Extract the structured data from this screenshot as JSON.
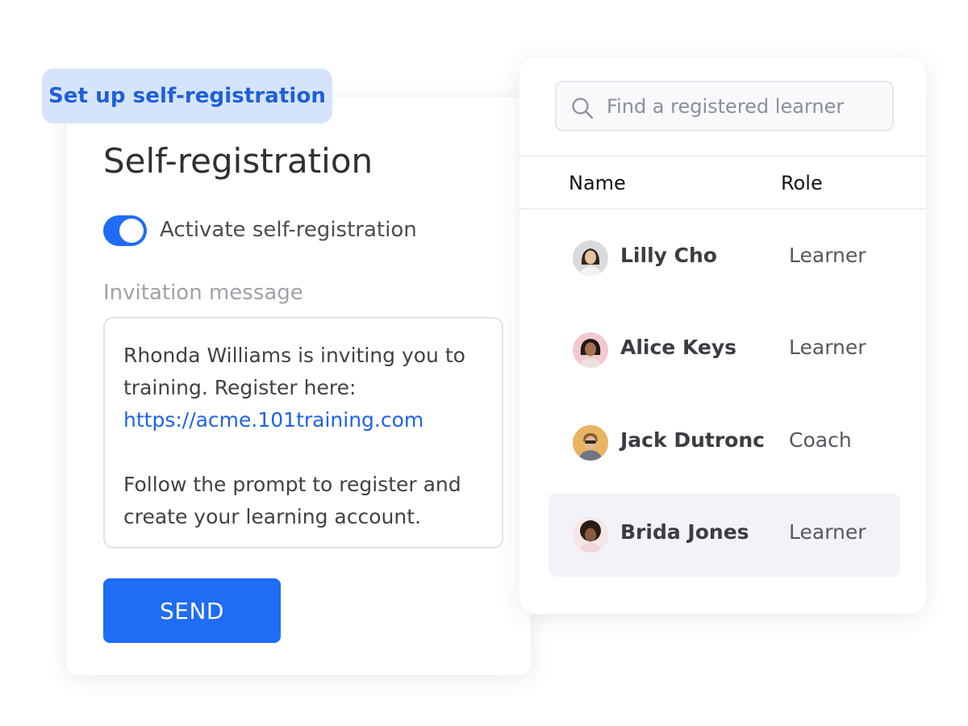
{
  "registration": {
    "chip_label": "Set up self-registration",
    "title": "Self-registration",
    "toggle": {
      "label": "Activate self-registration",
      "on": true
    },
    "message_label": "Invitation message",
    "message": {
      "line1": "Rhonda Williams is inviting you to",
      "line2": "training. Register here:",
      "link": "https://acme.101training.com",
      "line3": "Follow the prompt to register and",
      "line4": "create your learning account."
    },
    "send_label": "SEND"
  },
  "learners": {
    "search": {
      "placeholder": "Find a registered learner",
      "value": ""
    },
    "columns": {
      "name": "Name",
      "role": "Role"
    },
    "rows": [
      {
        "name": "Lilly Cho",
        "role": "Learner",
        "selected": false
      },
      {
        "name": "Alice Keys",
        "role": "Learner",
        "selected": false
      },
      {
        "name": "Jack Dutronc",
        "role": "Coach",
        "selected": false
      },
      {
        "name": "Brida Jones",
        "role": "Learner",
        "selected": true
      }
    ]
  },
  "colors": {
    "accent": "#1f6cf5",
    "chip_bg": "#d6e4fb",
    "chip_text": "#1f5fd9",
    "link": "#1f63e6",
    "selected_row": "#f2f2f8"
  },
  "icons": {
    "search": "search-icon",
    "toggle": "toggle-switch"
  }
}
